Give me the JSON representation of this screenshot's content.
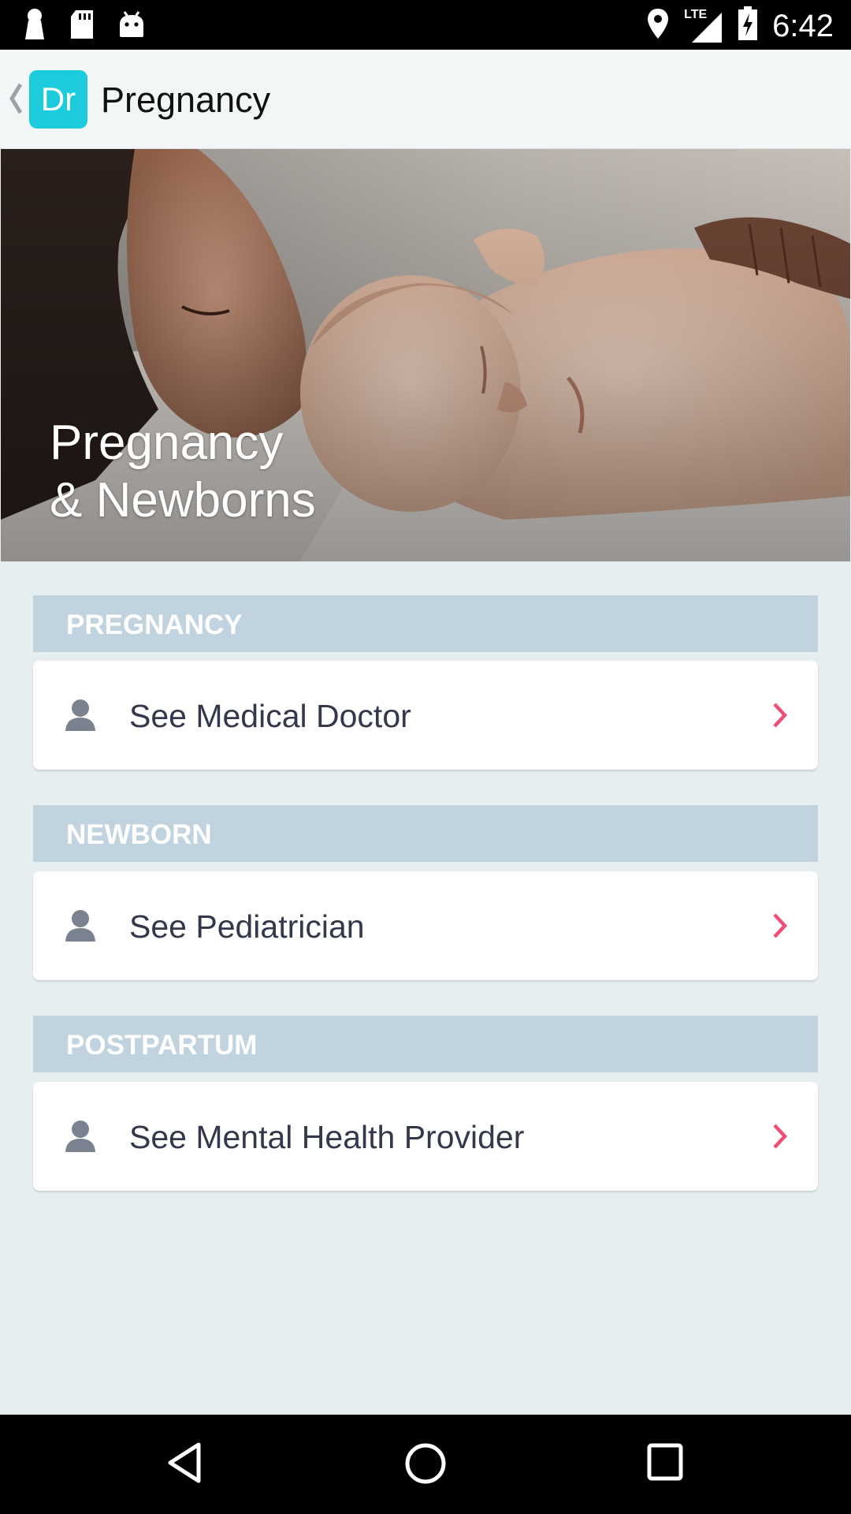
{
  "status_bar": {
    "network_label": "LTE",
    "time": "6:42"
  },
  "app_bar": {
    "logo_text": "Dr",
    "title": "Pregnancy"
  },
  "hero": {
    "title": "Pregnancy\n& Newborns"
  },
  "sections": [
    {
      "header": "PREGNANCY",
      "item": "See Medical Doctor"
    },
    {
      "header": "NEWBORN",
      "item": "See Pediatrician"
    },
    {
      "header": "POSTPARTUM",
      "item": "See Mental Health Provider"
    }
  ],
  "colors": {
    "accent_logo": "#1ccbdc",
    "section_header": "#c1d3de",
    "chevron": "#ee4f73",
    "page_background": "#e7eeef"
  },
  "icons": {
    "back": "chevron-left-icon",
    "person": "person-icon",
    "forward": "chevron-right-icon",
    "nav_back": "triangle-back-icon",
    "nav_home": "circle-home-icon",
    "nav_recents": "square-recents-icon"
  }
}
